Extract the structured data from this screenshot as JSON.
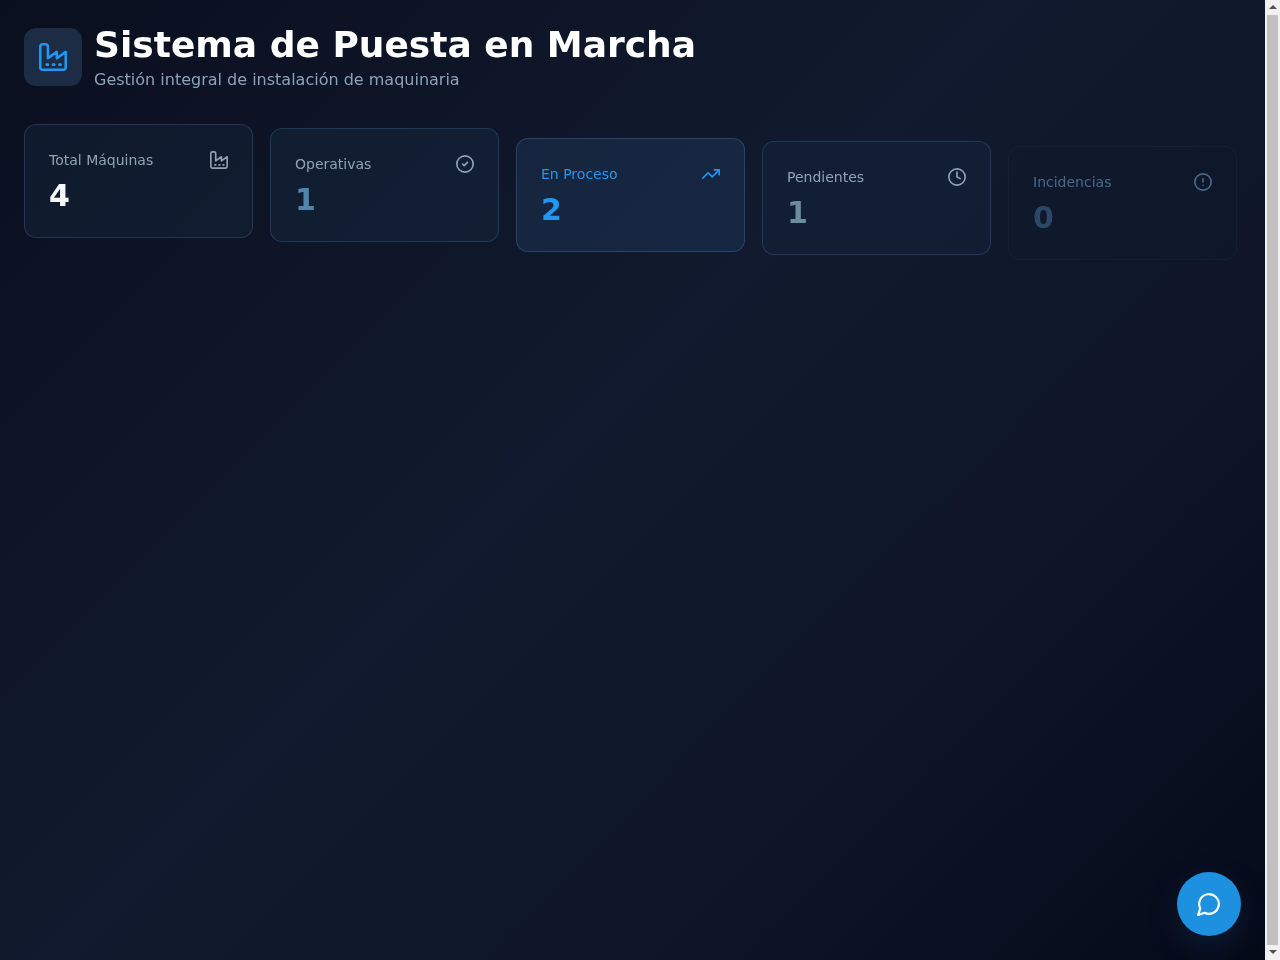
{
  "header": {
    "title": "Sistema de Puesta en Marcha",
    "subtitle": "Gestión integral de instalación de maquinaria"
  },
  "stats": [
    {
      "kind": "factory",
      "label": "Total Máquinas",
      "value": "4",
      "color": "#f4f6f8",
      "selected": false
    },
    {
      "kind": "check",
      "label": "Operativas",
      "value": "1",
      "color": "#4f86ab",
      "selected": false
    },
    {
      "kind": "trend",
      "label": "En Proceso",
      "value": "2",
      "color": "#2196f3",
      "selected": true
    },
    {
      "kind": "clock",
      "label": "Pendientes",
      "value": "1",
      "color": "#6c8e9a",
      "selected": false
    },
    {
      "kind": "alert",
      "label": "Incidencias",
      "value": "0",
      "color": "#2b4868",
      "selected": false
    }
  ]
}
